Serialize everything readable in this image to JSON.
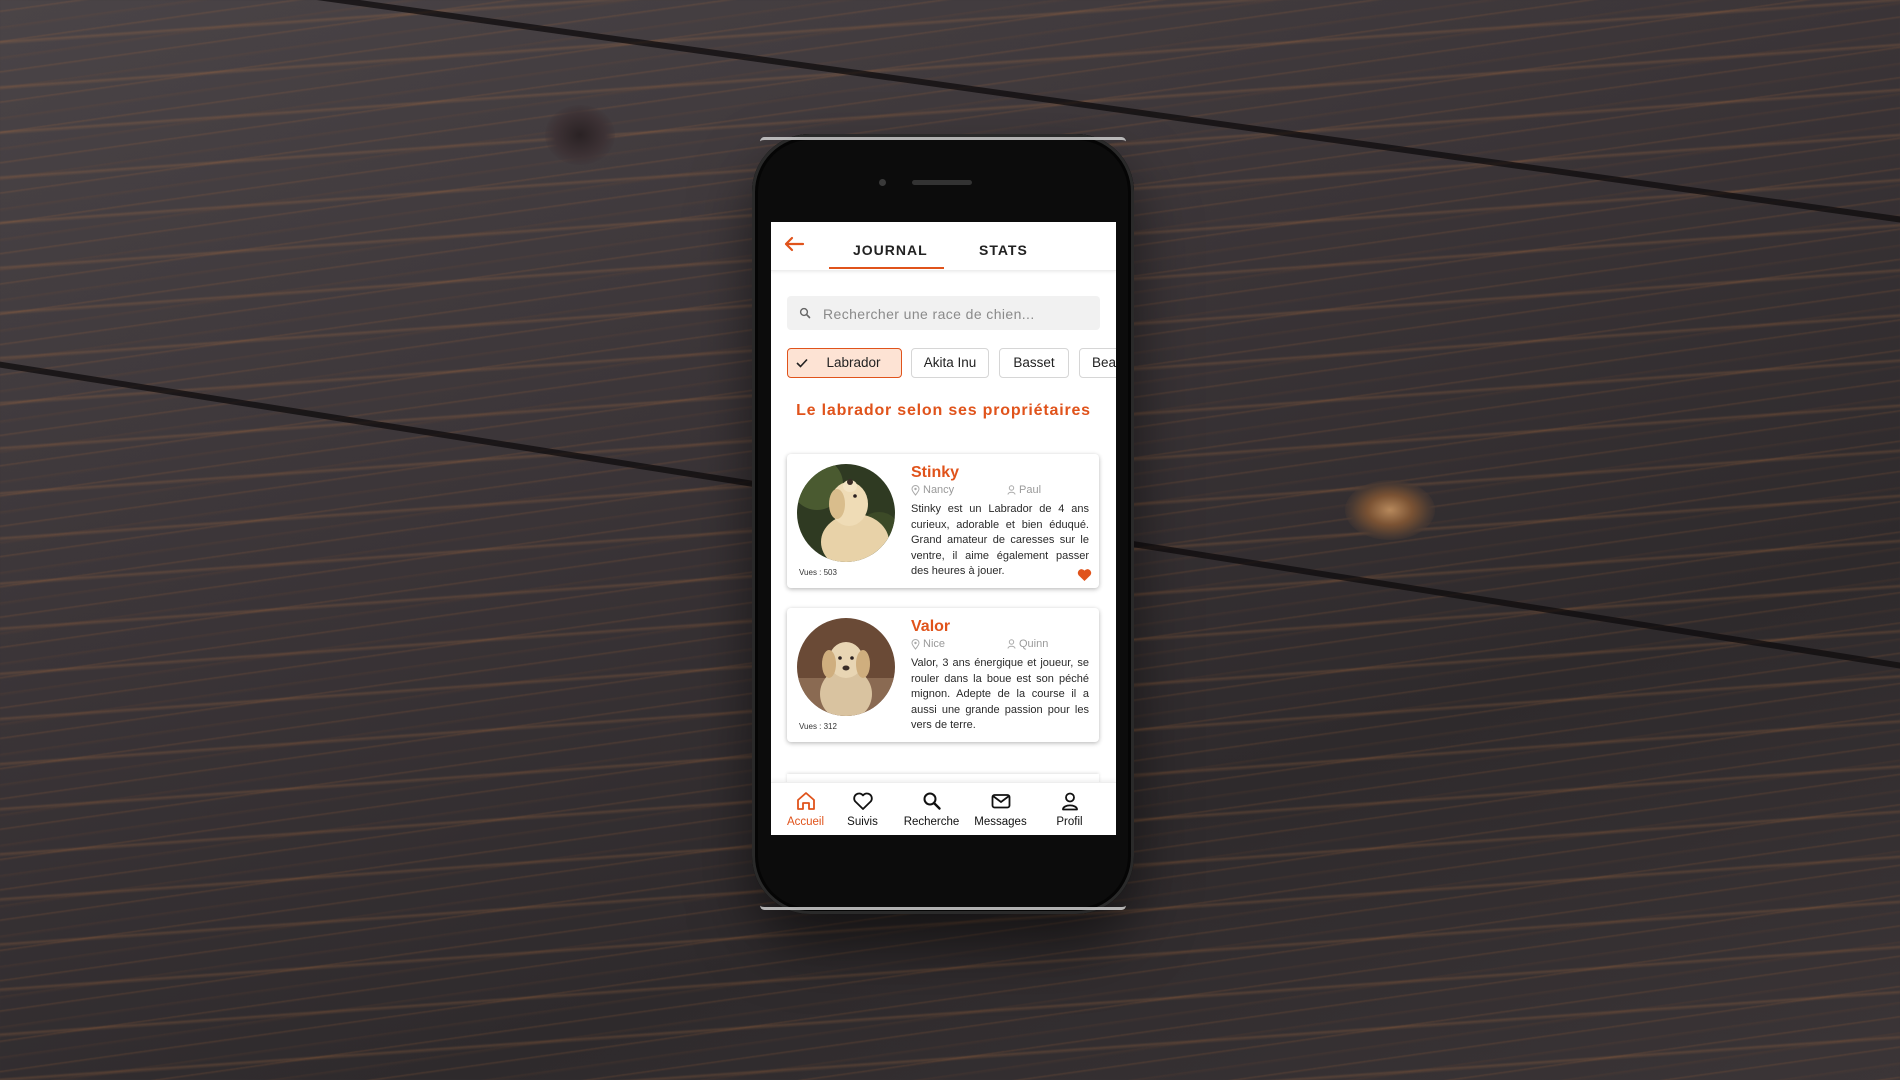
{
  "app": {
    "accent_color": "#e0531b"
  },
  "header": {
    "back_icon": "arrow-left-icon",
    "tabs": [
      {
        "label": "JOURNAL",
        "active": true
      },
      {
        "label": "STATS",
        "active": false
      }
    ]
  },
  "search": {
    "placeholder": "Rechercher une race de chien..."
  },
  "breed_chips": [
    {
      "label": "Labrador",
      "selected": true
    },
    {
      "label": "Akita Inu",
      "selected": false
    },
    {
      "label": "Basset",
      "selected": false
    },
    {
      "label": "Bea",
      "selected": false
    }
  ],
  "section": {
    "title": "Le labrador selon ses propriétaires"
  },
  "dogs": [
    {
      "name": "Stinky",
      "city": "Nancy",
      "owner": "Paul",
      "description": "Stinky est un Labrador de 4 ans curieux, adorable et bien éduqué. Grand amateur de caresses sur le ventre, il aime également passer des heures à jouer.",
      "views": "Vues : 503",
      "liked": true
    },
    {
      "name": "Valor",
      "city": "Nice",
      "owner": "Quinn",
      "description": "Valor, 3 ans énergique et joueur, se rouler dans la boue est son péché mignon. Adepte de la course il a aussi une grande passion pour les vers de terre.",
      "views": "Vues : 312",
      "liked": false
    }
  ],
  "bottom_nav": [
    {
      "label": "Accueil",
      "icon": "home-icon",
      "active": true
    },
    {
      "label": "Suivis",
      "icon": "heart-icon",
      "active": false
    },
    {
      "label": "Recherche",
      "icon": "search-icon",
      "active": false
    },
    {
      "label": "Messages",
      "icon": "mail-icon",
      "active": false
    },
    {
      "label": "Profil",
      "icon": "user-icon",
      "active": false
    }
  ]
}
